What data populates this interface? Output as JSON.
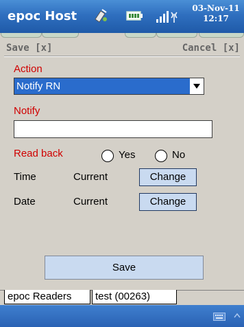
{
  "titlebar": {
    "app_title": "epoc Host",
    "date": "03-Nov-11",
    "time": "12:17",
    "icons": [
      "sync-icon",
      "battery-icon",
      "signal-icon"
    ]
  },
  "softkeys": {
    "left": "Save [x]",
    "right": "Cancel [x]"
  },
  "form": {
    "action_label": "Action",
    "action_value": "Notify RN",
    "notify_label": "Notify",
    "notify_value": "",
    "readback_label": "Read back",
    "yes_label": "Yes",
    "no_label": "No",
    "time_label": "Time",
    "time_value": "Current",
    "time_change": "Change",
    "date_label": "Date",
    "date_value": "Current",
    "date_change": "Change",
    "save_button": "Save"
  },
  "tabs": [
    {
      "label": "epoc Readers"
    },
    {
      "label": "test (00263)"
    }
  ],
  "colors": {
    "accent": "#2a6ccc",
    "required_label": "#d00000",
    "button_fill": "#c9daf0"
  }
}
